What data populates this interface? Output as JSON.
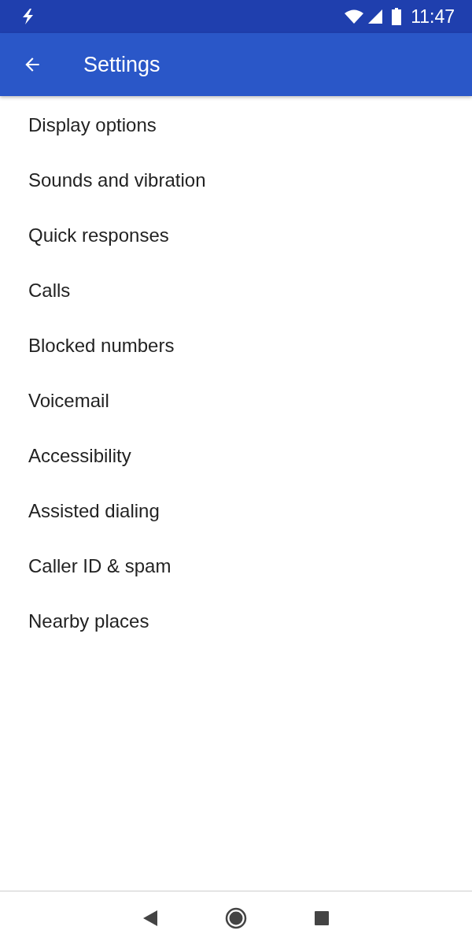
{
  "status_bar": {
    "time": "11:47"
  },
  "app_bar": {
    "title": "Settings"
  },
  "items": [
    {
      "label": "Display options"
    },
    {
      "label": "Sounds and vibration"
    },
    {
      "label": "Quick responses"
    },
    {
      "label": "Calls"
    },
    {
      "label": "Blocked numbers"
    },
    {
      "label": "Voicemail"
    },
    {
      "label": "Accessibility"
    },
    {
      "label": "Assisted dialing"
    },
    {
      "label": "Caller ID & spam"
    },
    {
      "label": "Nearby places"
    }
  ]
}
